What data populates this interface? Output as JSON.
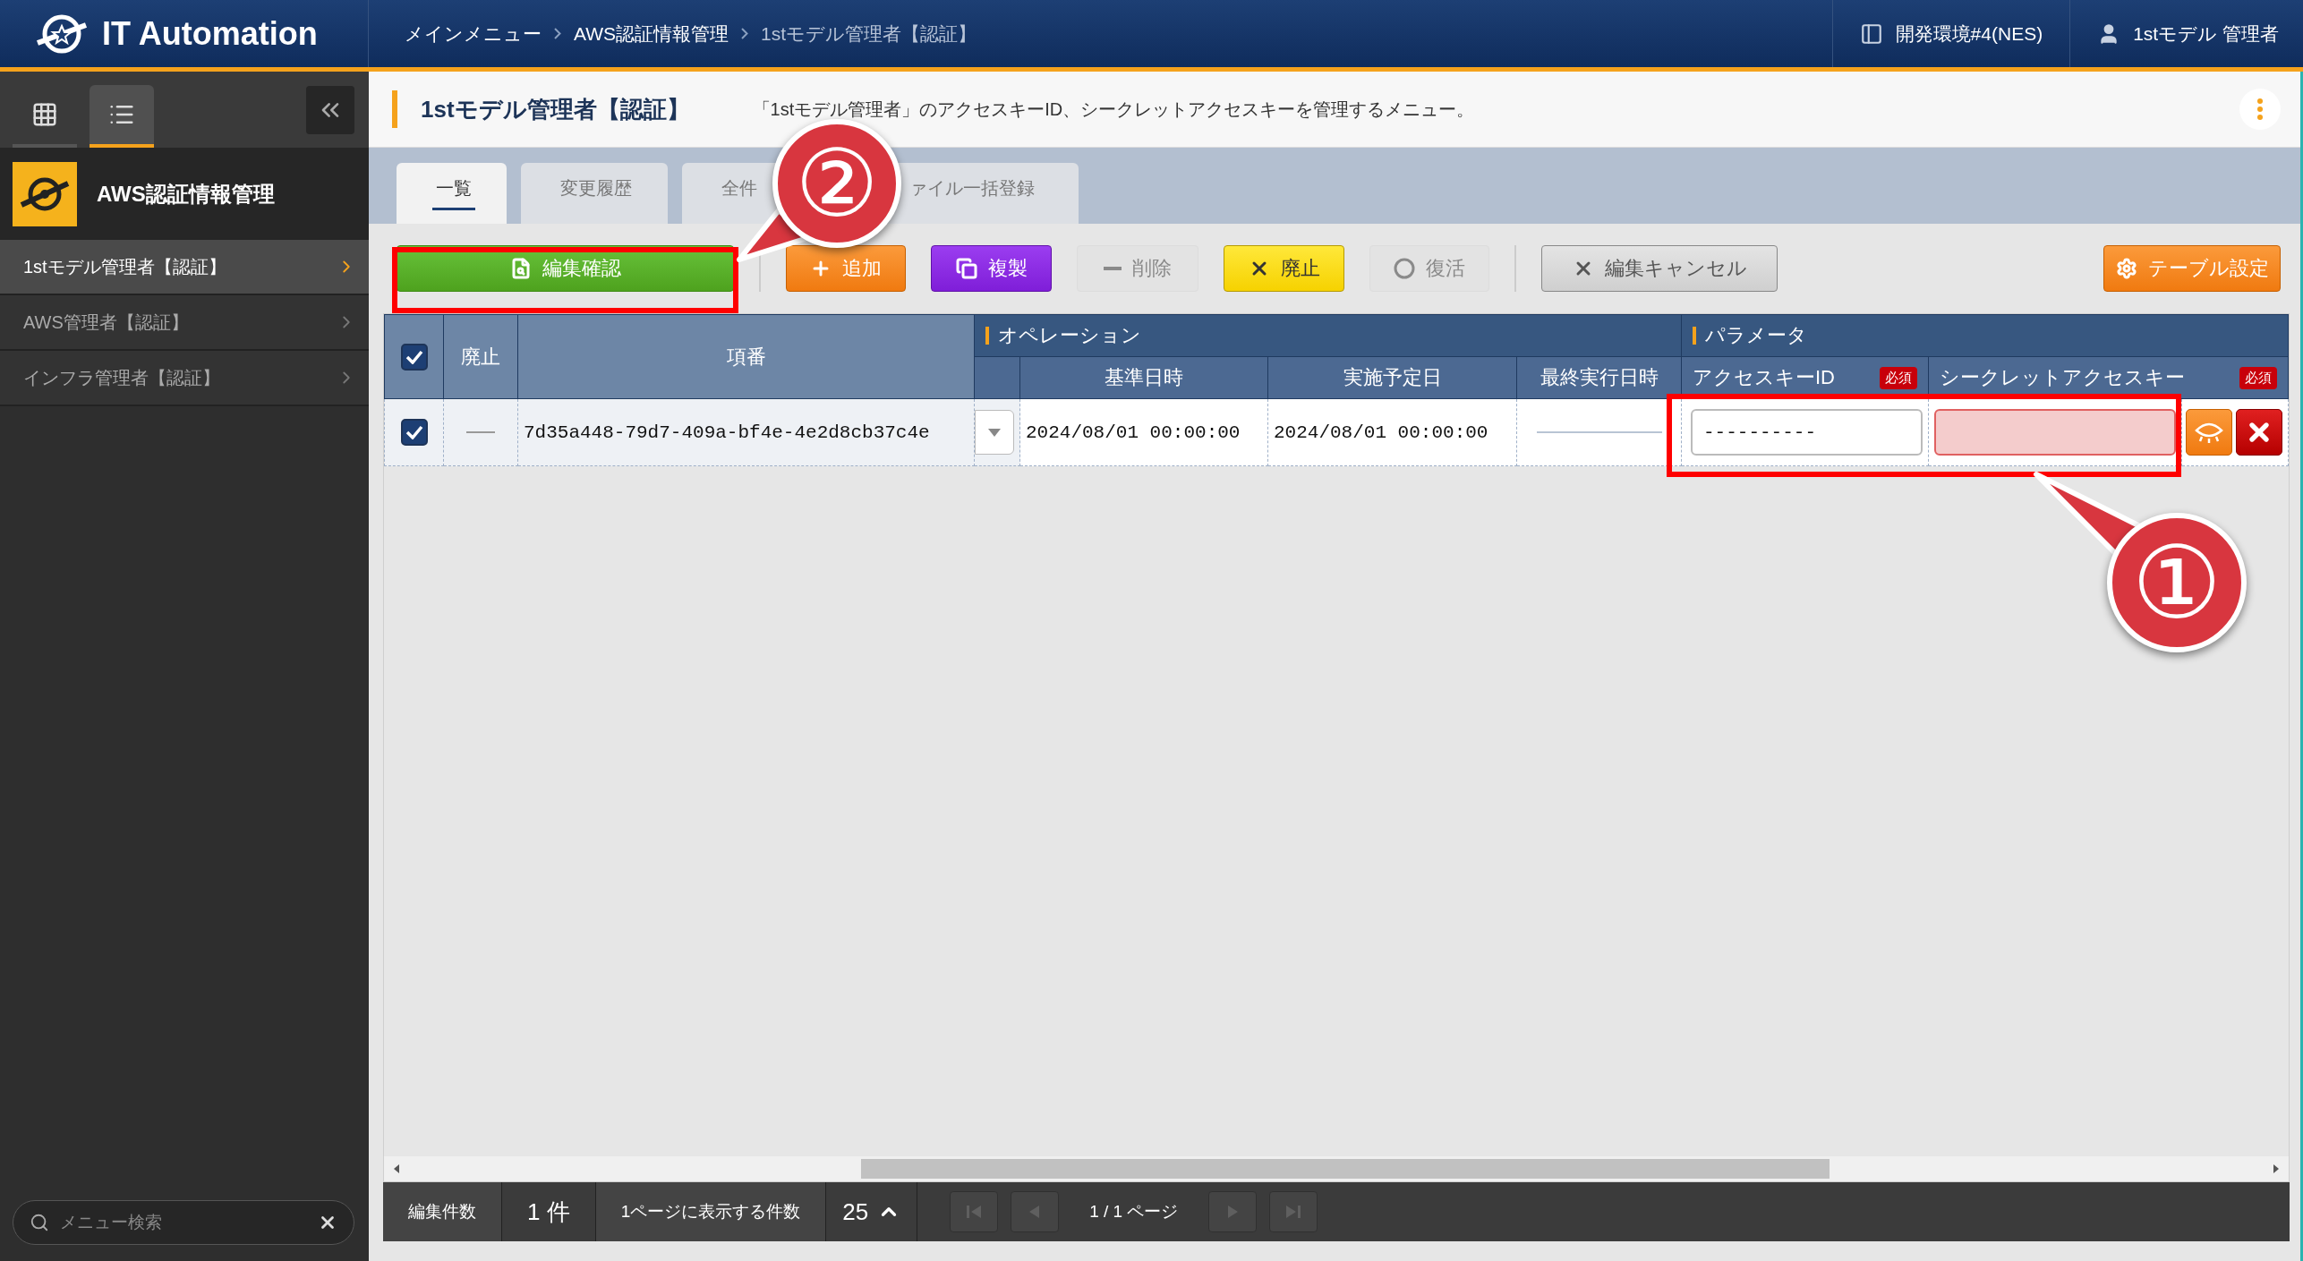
{
  "header": {
    "logo": "IT Automation",
    "breadcrumbs": [
      "メインメニュー",
      "AWS認証情報管理",
      "1stモデル管理者【認証】"
    ],
    "environment": "開発環境#4(NES)",
    "user": "1stモデル 管理者"
  },
  "sidebar": {
    "view_tabs": [
      {
        "kind": "grid",
        "selected": false
      },
      {
        "kind": "list",
        "selected": true
      }
    ],
    "group": "AWS認証情報管理",
    "items": [
      {
        "label": "1stモデル管理者【認証】",
        "selected": true
      },
      {
        "label": "AWS管理者【認証】",
        "selected": false
      },
      {
        "label": "インフラ管理者【認証】",
        "selected": false
      }
    ],
    "search": {
      "placeholder": "メニュー検索"
    }
  },
  "page": {
    "title": "1stモデル管理者【認証】",
    "description": "「1stモデル管理者」のアクセスキーID、シークレットアクセスキーを管理するメニュー。"
  },
  "tabs": [
    {
      "label": "一覧",
      "selected": true
    },
    {
      "label": "変更履歴",
      "selected": false
    },
    {
      "label": "全件",
      "selected": false
    },
    {
      "label": "ァイル一括登録",
      "selected": false
    }
  ],
  "toolbar": [
    {
      "kind": "confirm",
      "label": "編集確認",
      "disabled": false
    },
    {
      "kind": "add",
      "label": "追加",
      "disabled": false
    },
    {
      "kind": "duplicate",
      "label": "複製",
      "disabled": false
    },
    {
      "kind": "delete",
      "label": "削除",
      "disabled": true
    },
    {
      "kind": "discard",
      "label": "廃止",
      "disabled": false
    },
    {
      "kind": "restore",
      "label": "復活",
      "disabled": true
    },
    {
      "kind": "cancel",
      "label": "編集キャンセル",
      "disabled": false
    },
    {
      "kind": "settings",
      "label": "テーブル設定",
      "disabled": false
    }
  ],
  "table": {
    "select_all_checked": true,
    "columns": [
      {
        "label": "廃止"
      },
      {
        "label": "項番"
      }
    ],
    "operation_group": {
      "label": "オペレーション",
      "columns": [
        {
          "label": "基準日時"
        },
        {
          "label": "実施予定日"
        },
        {
          "label": "最終実行日時"
        }
      ]
    },
    "parameter_group": {
      "label": "パラメータ",
      "columns": [
        {
          "label": "アクセスキーID",
          "badge": "必須"
        },
        {
          "label": "シークレットアクセスキー",
          "badge": "必須"
        }
      ]
    },
    "rows": [
      {
        "checked": true,
        "id": "7d35a448-79d7-409a-bf4e-4e2d8cb37c4e",
        "base_datetime": "2024/08/01 00:00:00",
        "scheduled_date": "2024/08/01 00:00:00",
        "access_key_id": "----------",
        "secret_invalid": true
      }
    ]
  },
  "footer": {
    "edit_count_label": "編集件数",
    "edit_count": "1 件",
    "per_page_label": "1ページに表示する件数",
    "per_page": "25",
    "page_info": "1 / 1 ページ"
  },
  "annotations": [
    {
      "number": "②"
    },
    {
      "number": "①"
    }
  ]
}
